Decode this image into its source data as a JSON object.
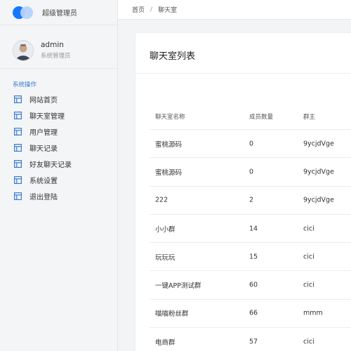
{
  "brand": {
    "title": "超级管理员"
  },
  "user": {
    "name": "admin",
    "role": "系统管理员"
  },
  "sidebar": {
    "section": "系统操作",
    "items": [
      {
        "label": "网站首页",
        "icon": "table-icon"
      },
      {
        "label": "聊天室管理",
        "icon": "table-icon"
      },
      {
        "label": "用户管理",
        "icon": "table-icon"
      },
      {
        "label": "聊天记录",
        "icon": "table-icon"
      },
      {
        "label": "好友聊天记录",
        "icon": "table-icon"
      },
      {
        "label": "系统设置",
        "icon": "table-icon"
      },
      {
        "label": "退出登陆",
        "icon": "table-icon"
      }
    ]
  },
  "breadcrumb": {
    "home": "首页",
    "separator": "/",
    "current": "聊天室"
  },
  "main": {
    "title": "聊天室列表",
    "table": {
      "headers": [
        "聊天室名称",
        "成员数量",
        "群主"
      ],
      "rows": [
        [
          "蜜桃源码",
          "0",
          "9ycjdVge"
        ],
        [
          "蜜桃源码",
          "0",
          "9ycjdVge"
        ],
        [
          "222",
          "2",
          "9ycjdVge"
        ],
        [
          "小小群",
          "14",
          "cici"
        ],
        [
          "玩玩玩",
          "15",
          "cici"
        ],
        [
          "一键APP测试群",
          "60",
          "cici"
        ],
        [
          "喵喵粉丝群",
          "66",
          "mmm"
        ],
        [
          "电商群",
          "57",
          "cici"
        ]
      ]
    }
  },
  "colors": {
    "accent": "#1677ff",
    "accent_light": "#b7d2fb",
    "section_label": "#3a7bd5",
    "nav_icon": "#3a7bd5"
  }
}
